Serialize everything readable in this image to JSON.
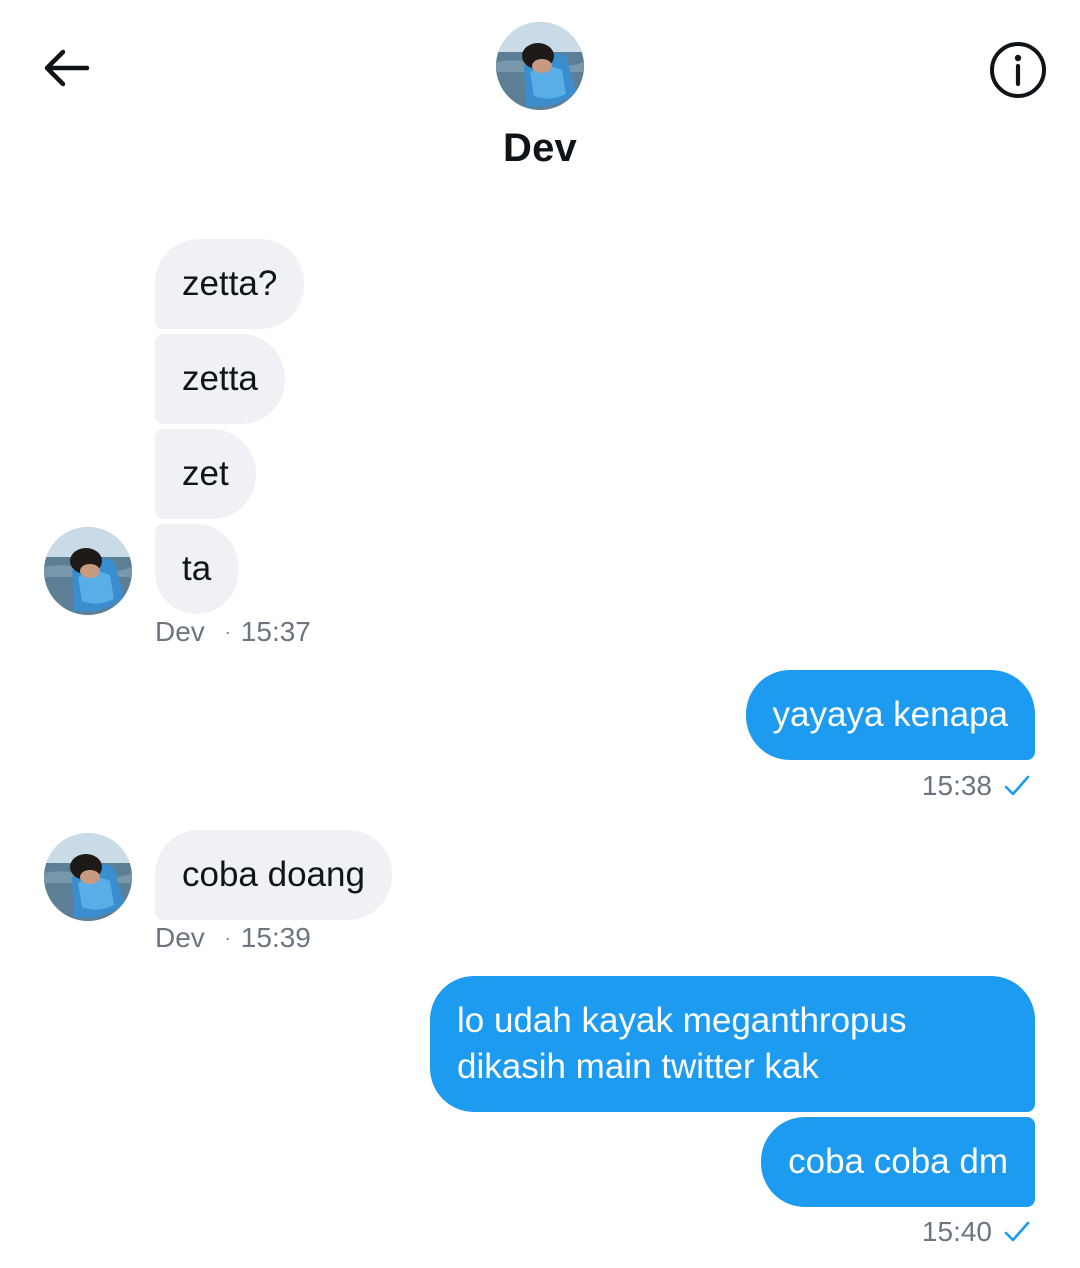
{
  "header": {
    "back_icon": "arrow-left-icon",
    "info_icon": "info-circle-icon",
    "contact_name": "Dev"
  },
  "colors": {
    "accent": "#1d9bf0",
    "incoming_bubble": "#eff1f4",
    "meta_text": "#6b7680"
  },
  "messages": [
    {
      "direction": "incoming",
      "bubbles": [
        "zetta?",
        "zetta",
        "zet",
        "ta"
      ],
      "sender": "Dev",
      "separator": "·",
      "time": "15:37"
    },
    {
      "direction": "outgoing",
      "bubbles": [
        "yayaya kenapa"
      ],
      "time": "15:38",
      "status_icon": "sent-check-icon"
    },
    {
      "direction": "incoming",
      "bubbles": [
        "coba doang"
      ],
      "sender": "Dev",
      "separator": "·",
      "time": "15:39"
    },
    {
      "direction": "outgoing",
      "bubbles": [
        "lo udah kayak meganthropus dikasih main twitter kak",
        "coba coba dm"
      ],
      "time": "15:40",
      "status_icon": "sent-check-icon"
    }
  ]
}
